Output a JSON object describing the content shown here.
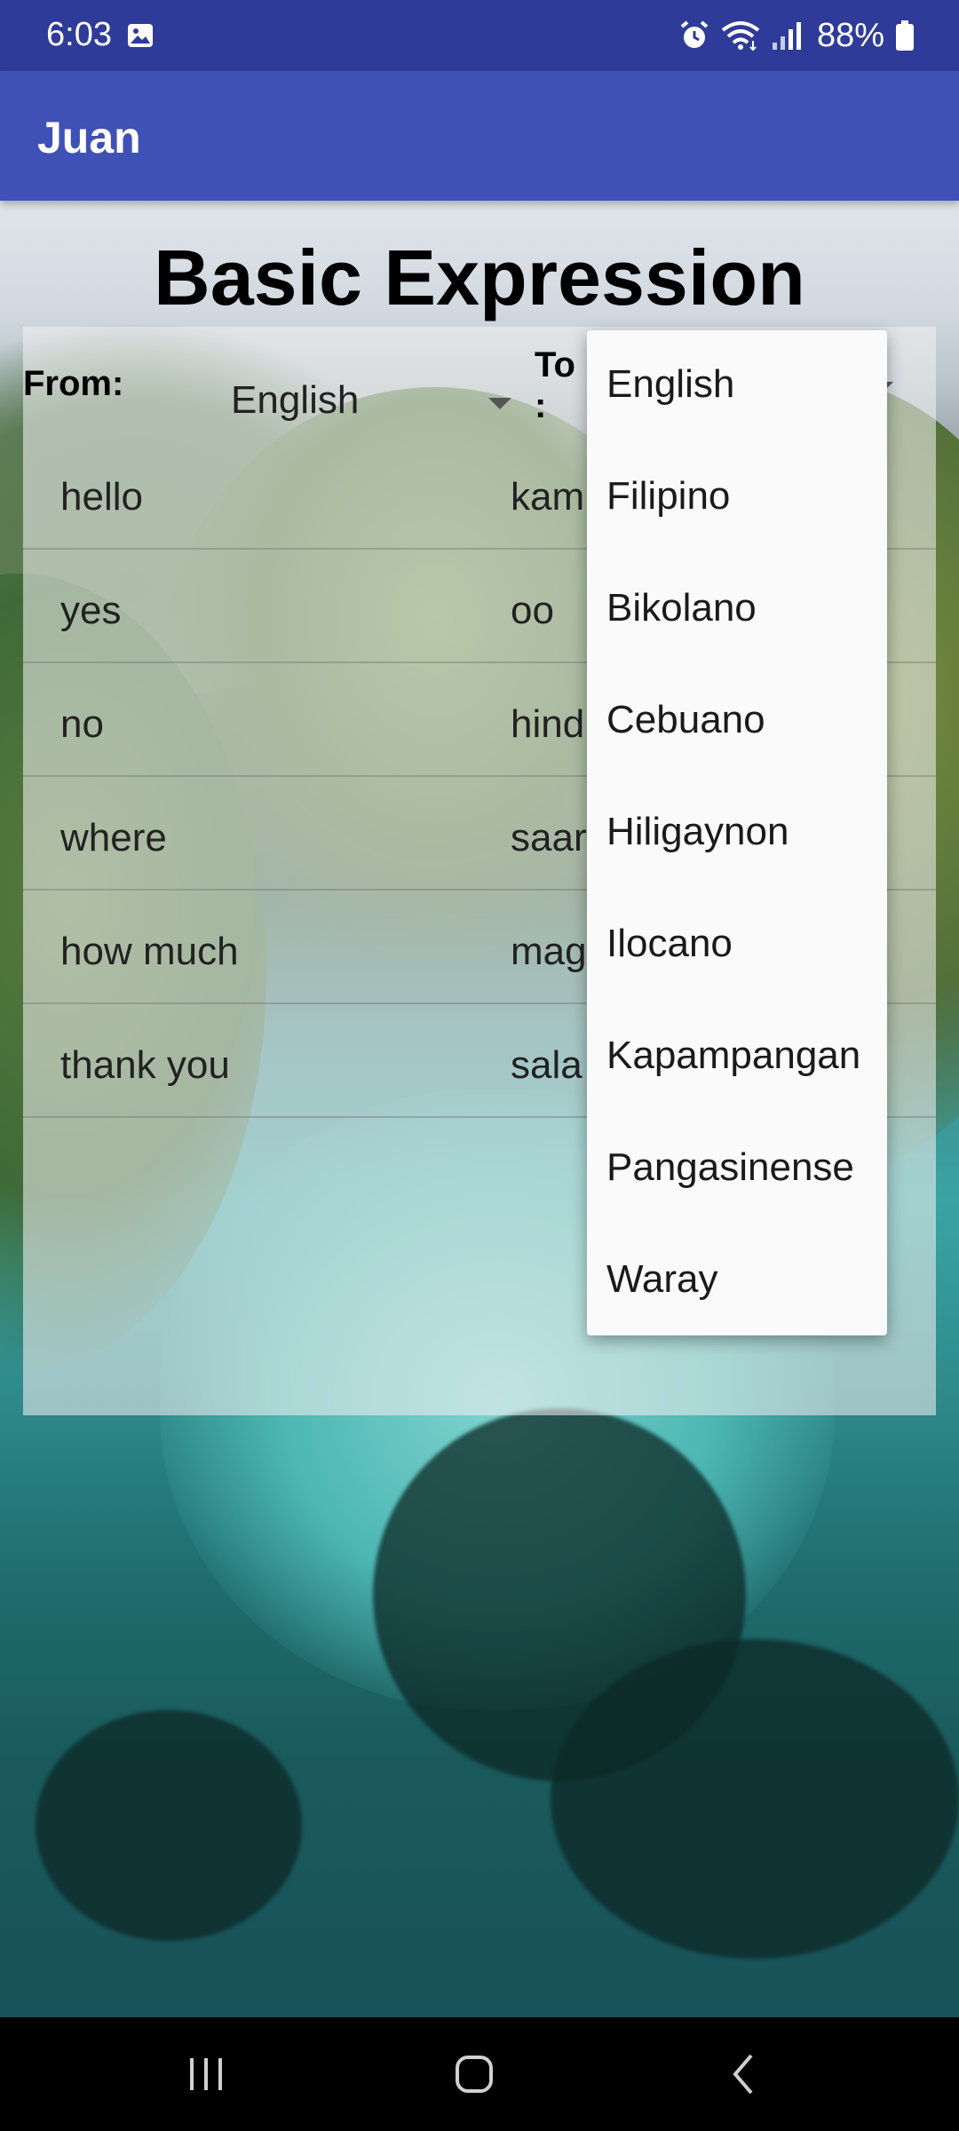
{
  "status_bar": {
    "time": "6:03",
    "battery": "88%",
    "icons": [
      "gallery-icon",
      "alarm-icon",
      "wifi-icon",
      "signal-icon",
      "battery-icon"
    ]
  },
  "app_bar": {
    "title": "Juan",
    "color": "#3f51b5"
  },
  "page": {
    "title": "Basic Expression"
  },
  "from": {
    "label": "From:",
    "selected": "English"
  },
  "to": {
    "label": "To\n:"
  },
  "expressions": [
    {
      "source": "hello",
      "target": "kam"
    },
    {
      "source": "yes",
      "target": "oo"
    },
    {
      "source": "no",
      "target": "hind"
    },
    {
      "source": "where",
      "target": "saar"
    },
    {
      "source": "how much",
      "target": "mag"
    },
    {
      "source": "thank you",
      "target": "sala"
    }
  ],
  "dropdown": {
    "options": [
      "English",
      "Filipino",
      "Bikolano",
      "Cebuano",
      "Hiligaynon",
      "Ilocano",
      "Kapampangan",
      "Pangasinense",
      "Waray"
    ]
  },
  "nav_bar": {
    "icons": [
      "recent-apps-icon",
      "home-icon",
      "back-icon"
    ]
  }
}
